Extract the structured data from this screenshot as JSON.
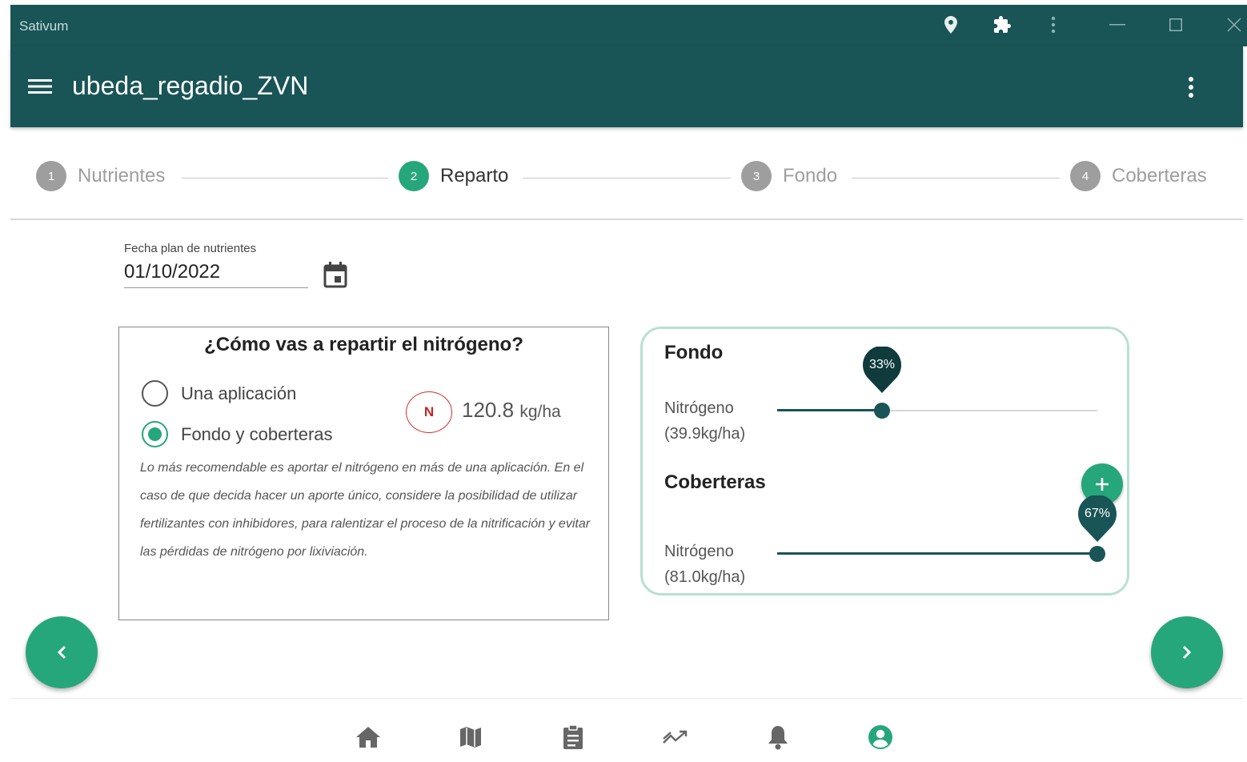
{
  "window": {
    "title": "Sativum",
    "toolbar_icons": [
      "location-pin-icon",
      "puzzle-icon",
      "more-vert-icon"
    ],
    "controls": [
      "minimize-icon",
      "maximize-icon",
      "close-icon"
    ]
  },
  "appbar": {
    "title": "ubeda_regadio_ZVN"
  },
  "stepper": {
    "steps": [
      {
        "num": "1",
        "label": "Nutrientes",
        "active": false
      },
      {
        "num": "2",
        "label": "Reparto",
        "active": true
      },
      {
        "num": "3",
        "label": "Fondo",
        "active": false
      },
      {
        "num": "4",
        "label": "Coberteras",
        "active": false
      }
    ]
  },
  "date": {
    "label": "Fecha plan de nutrientes",
    "value": "01/10/2022"
  },
  "reparto": {
    "question": "¿Cómo vas a repartir el nitrógeno?",
    "options": [
      {
        "label": "Una aplicación",
        "selected": false
      },
      {
        "label": "Fondo y coberteras",
        "selected": true
      }
    ],
    "badge": "N",
    "amount": "120.8",
    "unit": "kg/ha",
    "note": "Lo más recomendable es aportar el nitrógeno en más de una aplicación. En el caso de que decida hacer un aporte único, considere la posibilidad de utilizar fertilizantes con inhibidores, para ralentizar el proceso de la nitrificación y evitar las pérdidas de nitrógeno por lixiviación."
  },
  "distribution": {
    "fondo": {
      "title": "Fondo",
      "nutrient": "Nitrógeno",
      "amount": "(39.9kg/ha)",
      "percent_label": "33%",
      "percent": 33
    },
    "coberteras": {
      "title": "Coberteras",
      "nutrient": "Nitrógeno",
      "amount": "(81.0kg/ha)",
      "percent_label": "67%",
      "percent": 67
    }
  },
  "nav": {
    "prev_icon": "chevron-left-icon",
    "next_icon": "chevron-right-icon",
    "bottom_items": [
      "home-icon",
      "map-icon",
      "clipboard-icon",
      "trending-icon",
      "bell-icon",
      "account-icon"
    ],
    "active_item": "account-icon"
  },
  "colors": {
    "primary_dark": "#195456",
    "accent": "#26a67b",
    "card_border": "#b7e0d3",
    "nitrogen_badge": "#d32f2f"
  }
}
